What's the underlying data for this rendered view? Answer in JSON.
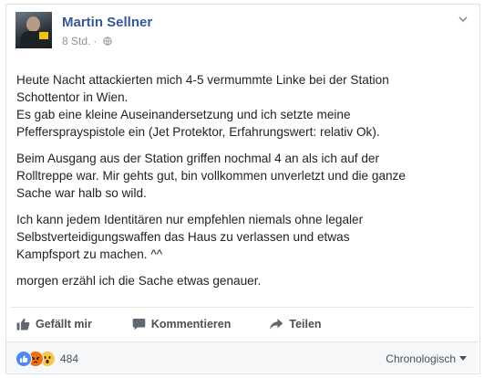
{
  "post": {
    "author": "Martin Sellner",
    "timestamp": "8 Std.",
    "privacy_icon": "globe-icon",
    "paragraphs": [
      "Heute Nacht attackierten mich 4-5 vermummte Linke bei der Station\nSchottentor in Wien.\nEs gab eine kleine Auseinandersetzung und ich setzte meine\nPfeffersprays­pistole ein (Jet Protektor, Erfahrungswert: relativ Ok).",
      "Beim Ausgang aus der Station griffen nochmal 4 an als ich auf der\nRolltreppe war. Mir gehts gut, bin vollkommen unverletzt und die ganze\nSache war halb so wild.",
      "Ich kann jedem Identitären nur empfehlen niemals ohne legaler\nSelbstverteidigungswaffen das Haus zu verlassen und etwas\nKampfsport zu machen. ^^",
      "morgen erzähl ich die Sache etwas genauer."
    ]
  },
  "actions": {
    "like_label": "Gefällt mir",
    "comment_label": "Kommentieren",
    "share_label": "Teilen"
  },
  "footer": {
    "reactions": [
      "like",
      "angry",
      "wow"
    ],
    "reaction_count": "484",
    "sort_label": "Chronologisch"
  },
  "colors": {
    "author": "#365899",
    "meta": "#90949c",
    "text": "#1d2129",
    "action_text": "#4b4f56",
    "like_reaction": "#4e88f2",
    "angry_reaction": "#e9710f",
    "wow_reaction": "#f7c54d"
  }
}
